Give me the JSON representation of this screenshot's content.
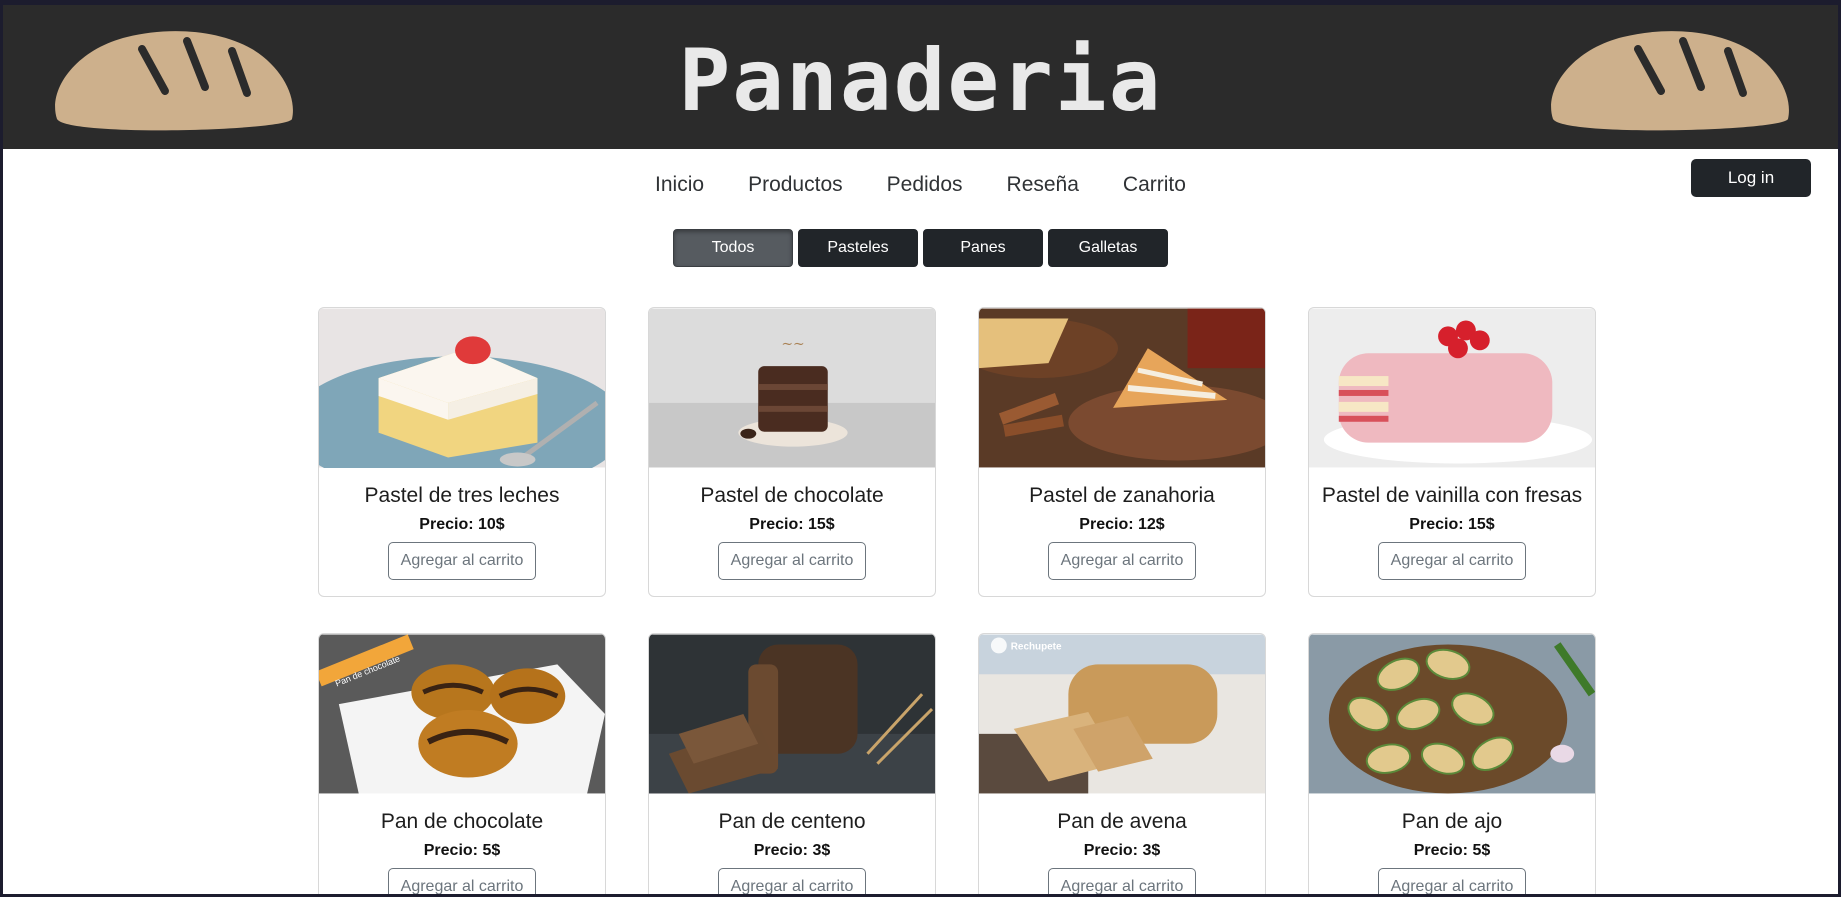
{
  "header": {
    "title": "Panaderia"
  },
  "nav": {
    "items": [
      "Inicio",
      "Productos",
      "Pedidos",
      "Reseña",
      "Carrito"
    ],
    "login_label": "Log in"
  },
  "filters": {
    "items": [
      "Todos",
      "Pasteles",
      "Panes",
      "Galletas"
    ],
    "active": "Todos"
  },
  "products": [
    {
      "name": "Pastel de tres leches",
      "price": "Precio: 10$",
      "button": "Agregar al carrito",
      "image": "tres-leches-cake-photo"
    },
    {
      "name": "Pastel de chocolate",
      "price": "Precio: 15$",
      "button": "Agregar al carrito",
      "image": "chocolate-cake-photo"
    },
    {
      "name": "Pastel de zanahoria",
      "price": "Precio: 12$",
      "button": "Agregar al carrito",
      "image": "carrot-cake-photo"
    },
    {
      "name": "Pastel de vainilla con fresas",
      "price": "Precio: 15$",
      "button": "Agregar al carrito",
      "image": "vanilla-strawberry-cake-photo"
    },
    {
      "name": "Pan de chocolate",
      "price": "Precio: 5$",
      "button": "Agregar al carrito",
      "image": "chocolate-bread-photo",
      "overlay": "Pan de chocolate"
    },
    {
      "name": "Pan de centeno",
      "price": "Precio: 3$",
      "button": "Agregar al carrito",
      "image": "rye-bread-photo"
    },
    {
      "name": "Pan de avena",
      "price": "Precio: 3$",
      "button": "Agregar al carrito",
      "image": "oat-bread-photo",
      "overlay": "Rechupete"
    },
    {
      "name": "Pan de ajo",
      "price": "Precio: 5$",
      "button": "Agregar al carrito",
      "image": "garlic-bread-photo"
    }
  ],
  "colors": {
    "header_bg": "#2b2b2b",
    "dark_button": "#212529",
    "active_filter": "#565b60",
    "outline_button": "#6c757d"
  }
}
